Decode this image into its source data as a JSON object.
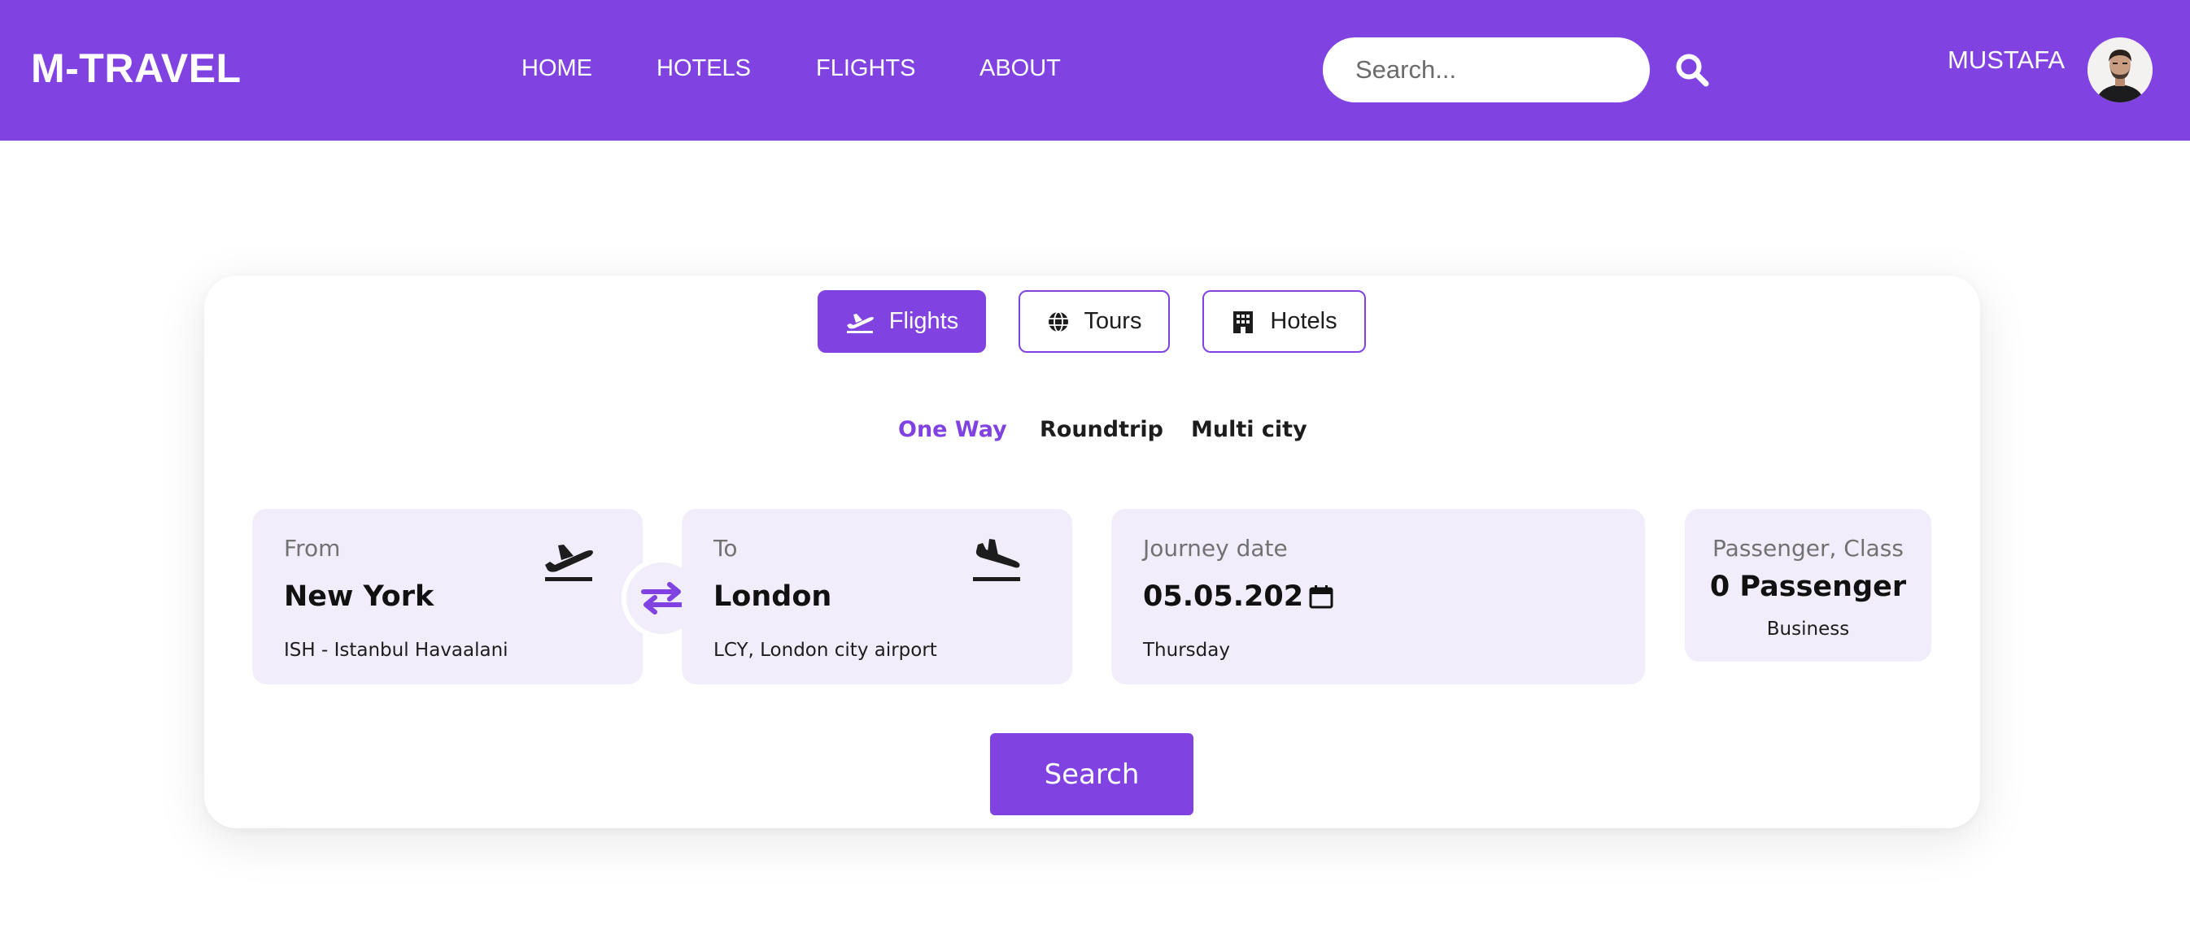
{
  "header": {
    "logo": "M-TRAVEL",
    "nav": [
      "HOME",
      "HOTELS",
      "FLIGHTS",
      "ABOUT"
    ],
    "search_placeholder": "Search...",
    "username": "MUSTAFA",
    "accent_color": "#8043e2"
  },
  "booking": {
    "tabs": [
      {
        "label": "Flights",
        "icon": "airplane-takeoff-icon",
        "active": true
      },
      {
        "label": "Tours",
        "icon": "globe-icon",
        "active": false
      },
      {
        "label": "Hotels",
        "icon": "building-icon",
        "active": false
      }
    ],
    "trip_types": [
      {
        "label": "One Way",
        "active": true
      },
      {
        "label": "Roundtrip",
        "active": false
      },
      {
        "label": "Multi city",
        "active": false
      }
    ],
    "from": {
      "label": "From",
      "value": "New York",
      "sub": "ISH - Istanbul Havaalani",
      "icon": "airplane-takeoff-icon"
    },
    "to": {
      "label": "To",
      "value": "London",
      "sub": "LCY, London city airport",
      "icon": "airplane-landing-icon"
    },
    "swap_icon": "swap-arrows-icon",
    "date": {
      "label": "Journey date",
      "value": "05.05.202",
      "sub": "Thursday",
      "icon": "calendar-icon"
    },
    "passenger": {
      "label": "Passenger, Class",
      "value": "0 Passenger",
      "sub": "Business"
    },
    "search_label": "Search",
    "field_bg": "#f2edfb"
  }
}
